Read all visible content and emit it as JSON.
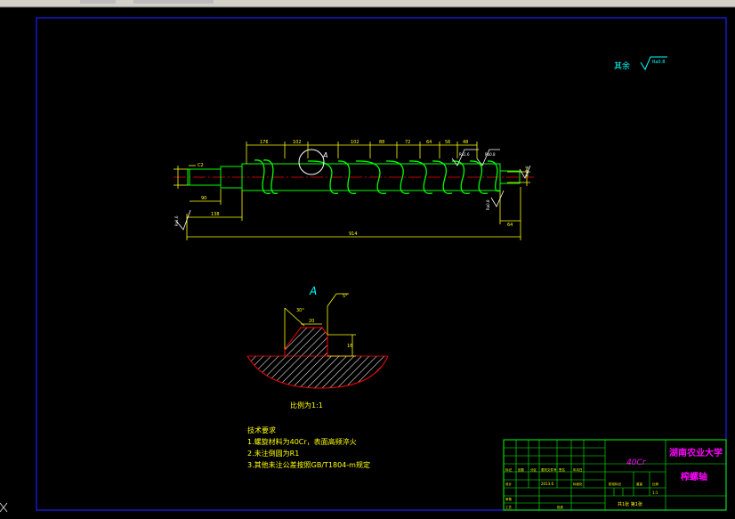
{
  "drawing": {
    "roughness_note_label": "其余",
    "roughness_symbol_value": "Ra0.8",
    "detail_label": "A",
    "detail_callout_label": "A",
    "scale_label": "比例为1:1",
    "tech_requirements": {
      "title": "技术要求",
      "items": [
        "1.螺旋材料为40Cr，表面高频淬火",
        "2.未注倒圆为R1",
        "3.其他未注公差按照GB/T1804-m规定"
      ]
    },
    "dimensions": {
      "overall_length": "914",
      "left_shoulder": "138",
      "left_step": "90",
      "pitch_1": "176",
      "pitch_2": "102",
      "pitch_3": "102",
      "pitch_4": "88",
      "pitch_5": "72",
      "pitch_6": "64",
      "pitch_7": "56",
      "pitch_8": "48",
      "right_end": "64",
      "chamfer": "C2",
      "angle_a": "30°",
      "angle_b": "5°",
      "thickness": "20",
      "height": "16"
    },
    "roughness_marks": [
      "Ra1.6",
      "Ra0.8",
      "Ra1.6",
      "Ra0.8",
      "Ra1.6"
    ]
  },
  "title_block": {
    "material": "40Cr",
    "school": "湖南农业大学",
    "part_name": "榨螺轴",
    "scale": "1:1",
    "sheet_info": "共1张 第1张",
    "date": "2013.6",
    "labels": [
      "标记",
      "处数",
      "分区",
      "更改文件号",
      "签名",
      "年月日",
      "设计",
      "标准化",
      "审核",
      "工艺",
      "批准",
      "阶段标记",
      "重量",
      "比例"
    ]
  },
  "colors": {
    "frame": "#1e1eff",
    "outline": "#00ff00",
    "dimension": "#ffff00",
    "hatch": "#ffffff",
    "centerline": "#ff0000",
    "text_magenta": "#ff00ff",
    "text_cyan": "#00ffff",
    "title_white": "#ffffff"
  }
}
